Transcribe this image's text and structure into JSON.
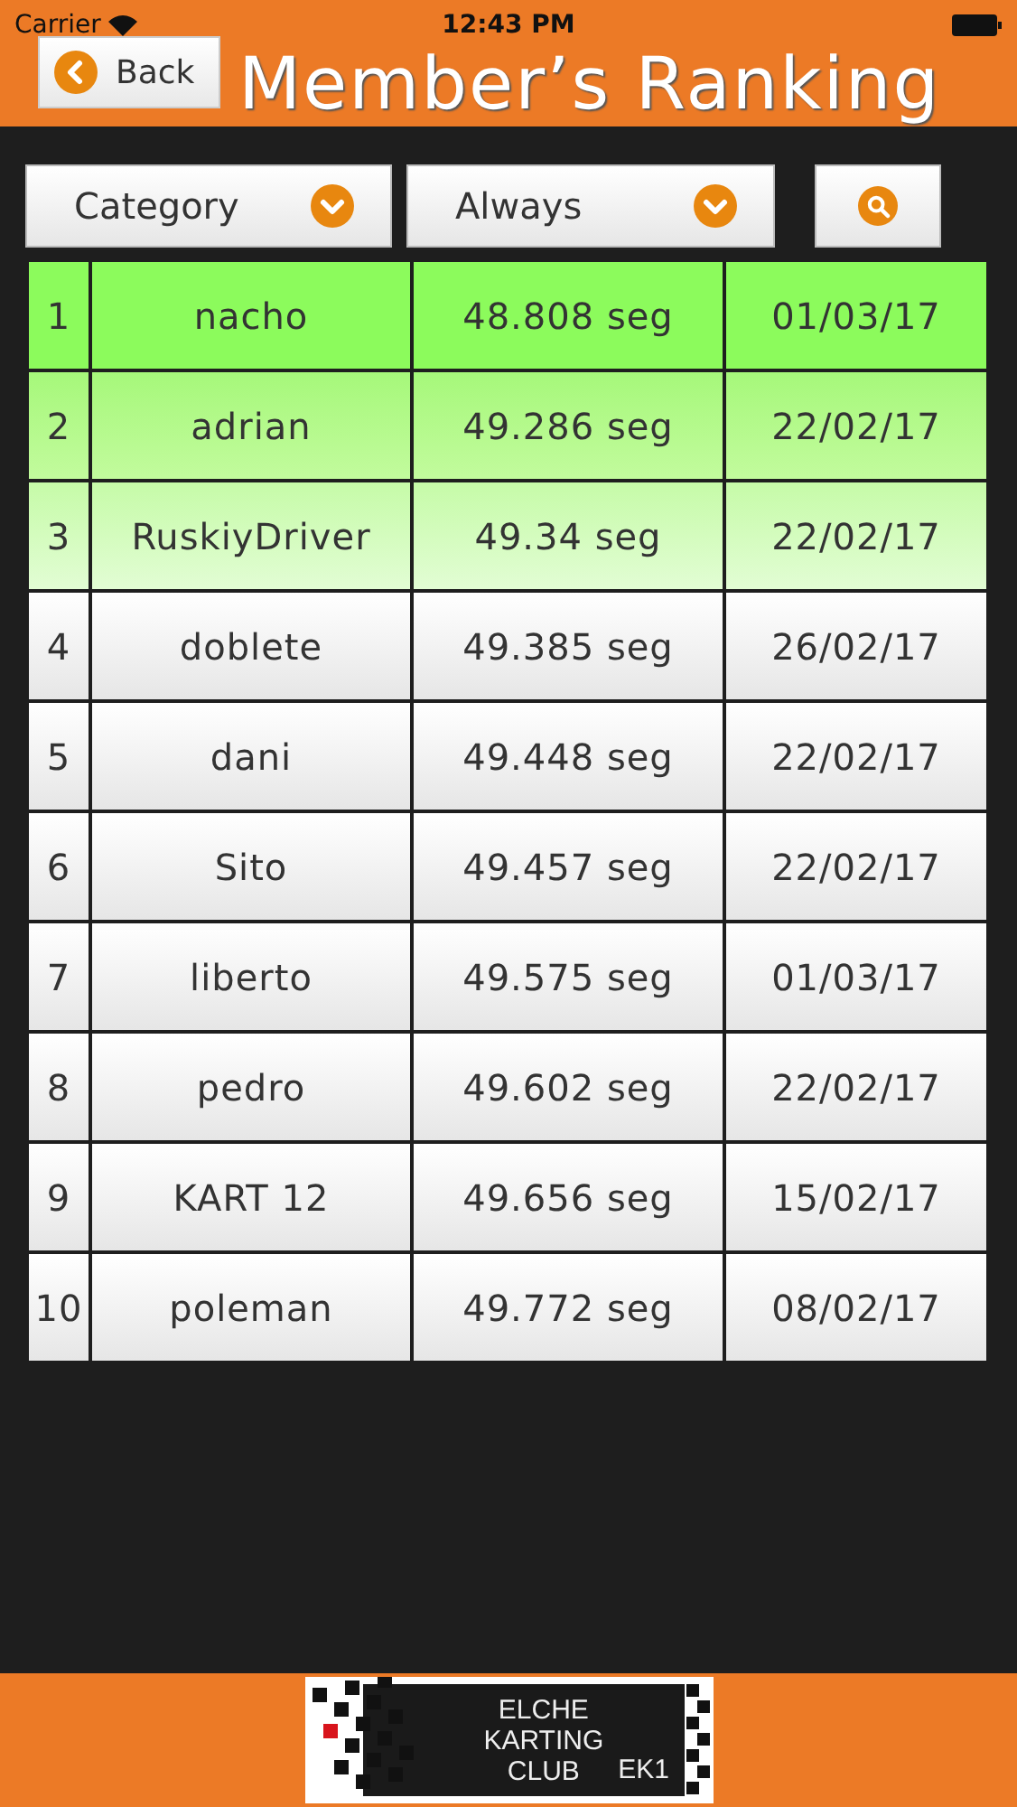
{
  "status_bar": {
    "carrier": "Carrier",
    "time": "12:43 PM"
  },
  "header": {
    "back_label": "Back",
    "title": "Member’s Ranking"
  },
  "filters": [
    {
      "label": "Category"
    },
    {
      "label": "Always"
    }
  ],
  "ranking": [
    {
      "rank": "1",
      "name": "nacho",
      "time": "48.808 seg",
      "date": "01/03/17",
      "kind": "first"
    },
    {
      "rank": "2",
      "name": "adrian",
      "time": "49.286 seg",
      "date": "22/02/17",
      "kind": "second"
    },
    {
      "rank": "3",
      "name": "RuskiyDriver",
      "time": "49.34 seg",
      "date": "22/02/17",
      "kind": "third"
    },
    {
      "rank": "4",
      "name": "doblete",
      "time": "49.385 seg",
      "date": "26/02/17",
      "kind": "normal"
    },
    {
      "rank": "5",
      "name": "dani",
      "time": "49.448 seg",
      "date": "22/02/17",
      "kind": "normal"
    },
    {
      "rank": "6",
      "name": "Sito",
      "time": "49.457 seg",
      "date": "22/02/17",
      "kind": "normal"
    },
    {
      "rank": "7",
      "name": "liberto",
      "time": "49.575 seg",
      "date": "01/03/17",
      "kind": "normal"
    },
    {
      "rank": "8",
      "name": "pedro",
      "time": "49.602 seg",
      "date": "22/02/17",
      "kind": "normal"
    },
    {
      "rank": "9",
      "name": "KART 12",
      "time": "49.656 seg",
      "date": "15/02/17",
      "kind": "normal"
    },
    {
      "rank": "10",
      "name": "poleman",
      "time": "49.772 seg",
      "date": "08/02/17",
      "kind": "normal"
    }
  ],
  "footer": {
    "logo_lines": [
      "ELCHE",
      "KARTING",
      "CLUB"
    ],
    "logo_tag": "EK1"
  }
}
